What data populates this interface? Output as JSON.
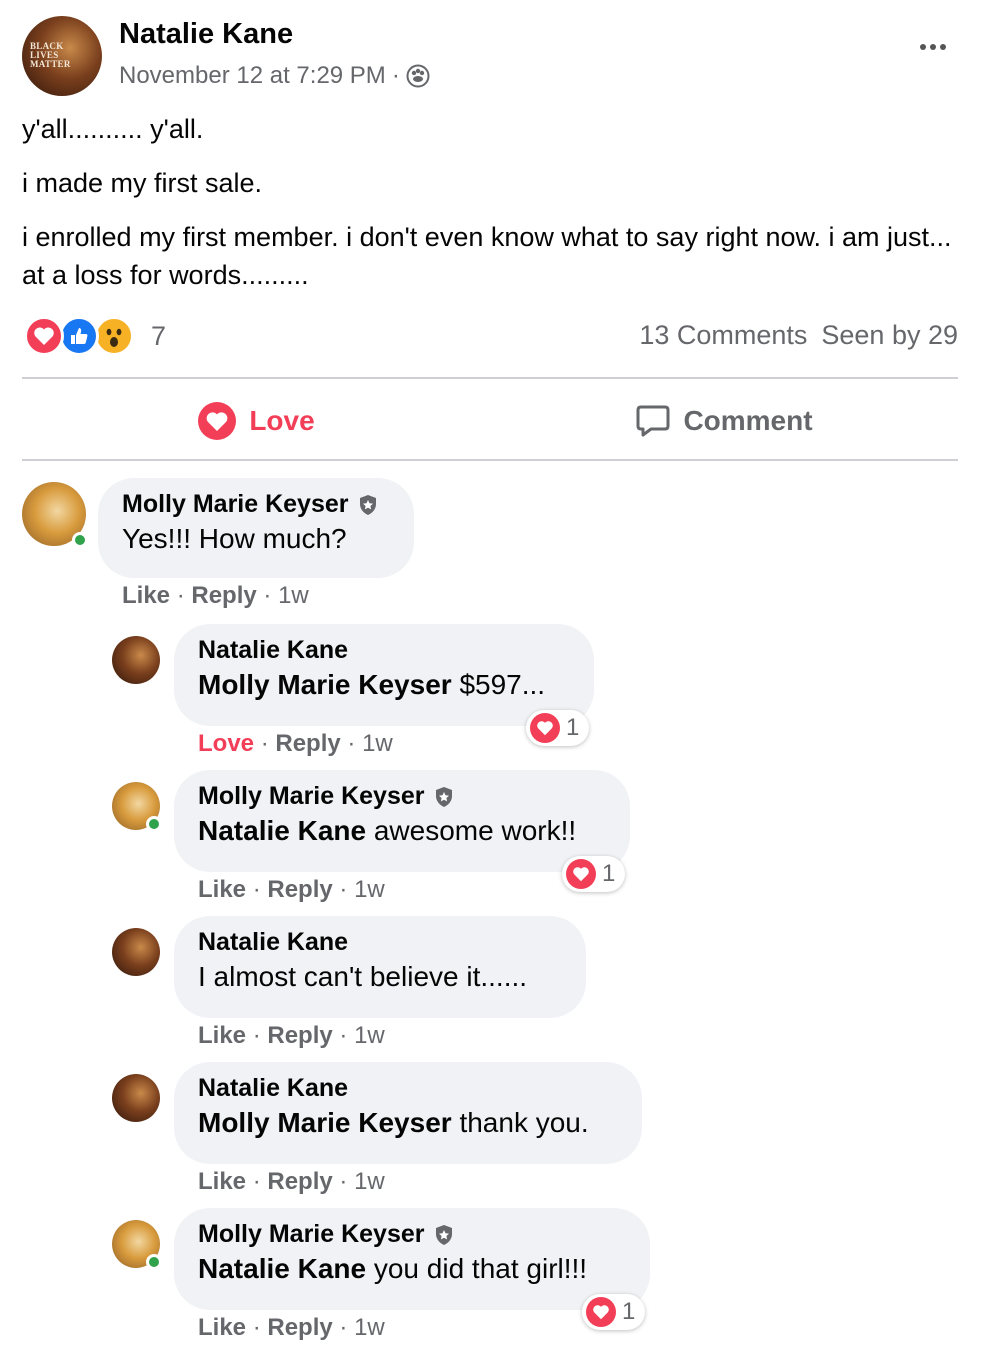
{
  "post": {
    "author": "Natalie Kane",
    "timestamp": "November 12 at 7:29 PM",
    "separator": "·",
    "privacy_icon": "group-icon",
    "avatar_text": [
      "BLACK",
      "LIVES",
      "MATTER"
    ],
    "paragraphs": [
      "y'all.......... y'all.",
      "i made my first sale.",
      "i enrolled my first member. i don't even know what to say right now. i am just... at a loss for words........."
    ]
  },
  "stats": {
    "reaction_icons": [
      "love-icon",
      "like-icon",
      "wow-icon"
    ],
    "reaction_count": "7",
    "comments": "13 Comments",
    "seen_by": "Seen by 29"
  },
  "actions": {
    "love_label": "Love",
    "comment_label": "Comment"
  },
  "colors": {
    "love": "#f33e58",
    "like": "#1877f2",
    "wow": "#f7b125",
    "bubble": "#f0f2f5",
    "meta": "#65676b",
    "online": "#31a24c"
  },
  "comments": [
    {
      "author": "Molly Marie Keyser",
      "verified": true,
      "mention": "",
      "text": "Yes!!! How much?",
      "like": "Like",
      "reply": "Reply",
      "time": "1w",
      "sep": "·",
      "reaction_count": ""
    },
    {
      "author": "Natalie Kane",
      "verified": false,
      "mention": "Molly Marie Keyser",
      "text": " $597...",
      "like": "Love",
      "reply": "Reply",
      "time": "1w",
      "sep": "·",
      "reaction_count": "1"
    },
    {
      "author": "Molly Marie Keyser",
      "verified": true,
      "mention": "Natalie Kane",
      "text": " awesome work!!",
      "like": "Like",
      "reply": "Reply",
      "time": "1w",
      "sep": "·",
      "reaction_count": "1"
    },
    {
      "author": "Natalie Kane",
      "verified": false,
      "mention": "",
      "text": "I almost can't believe it......",
      "like": "Like",
      "reply": "Reply",
      "time": "1w",
      "sep": "·",
      "reaction_count": ""
    },
    {
      "author": "Natalie Kane",
      "verified": false,
      "mention": "Molly Marie Keyser",
      "text": " thank you.",
      "like": "Like",
      "reply": "Reply",
      "time": "1w",
      "sep": "·",
      "reaction_count": ""
    },
    {
      "author": "Molly Marie Keyser",
      "verified": true,
      "mention": "Natalie Kane",
      "text": " you did that girl!!!",
      "like": "Like",
      "reply": "Reply",
      "time": "1w",
      "sep": "·",
      "reaction_count": "1"
    }
  ]
}
